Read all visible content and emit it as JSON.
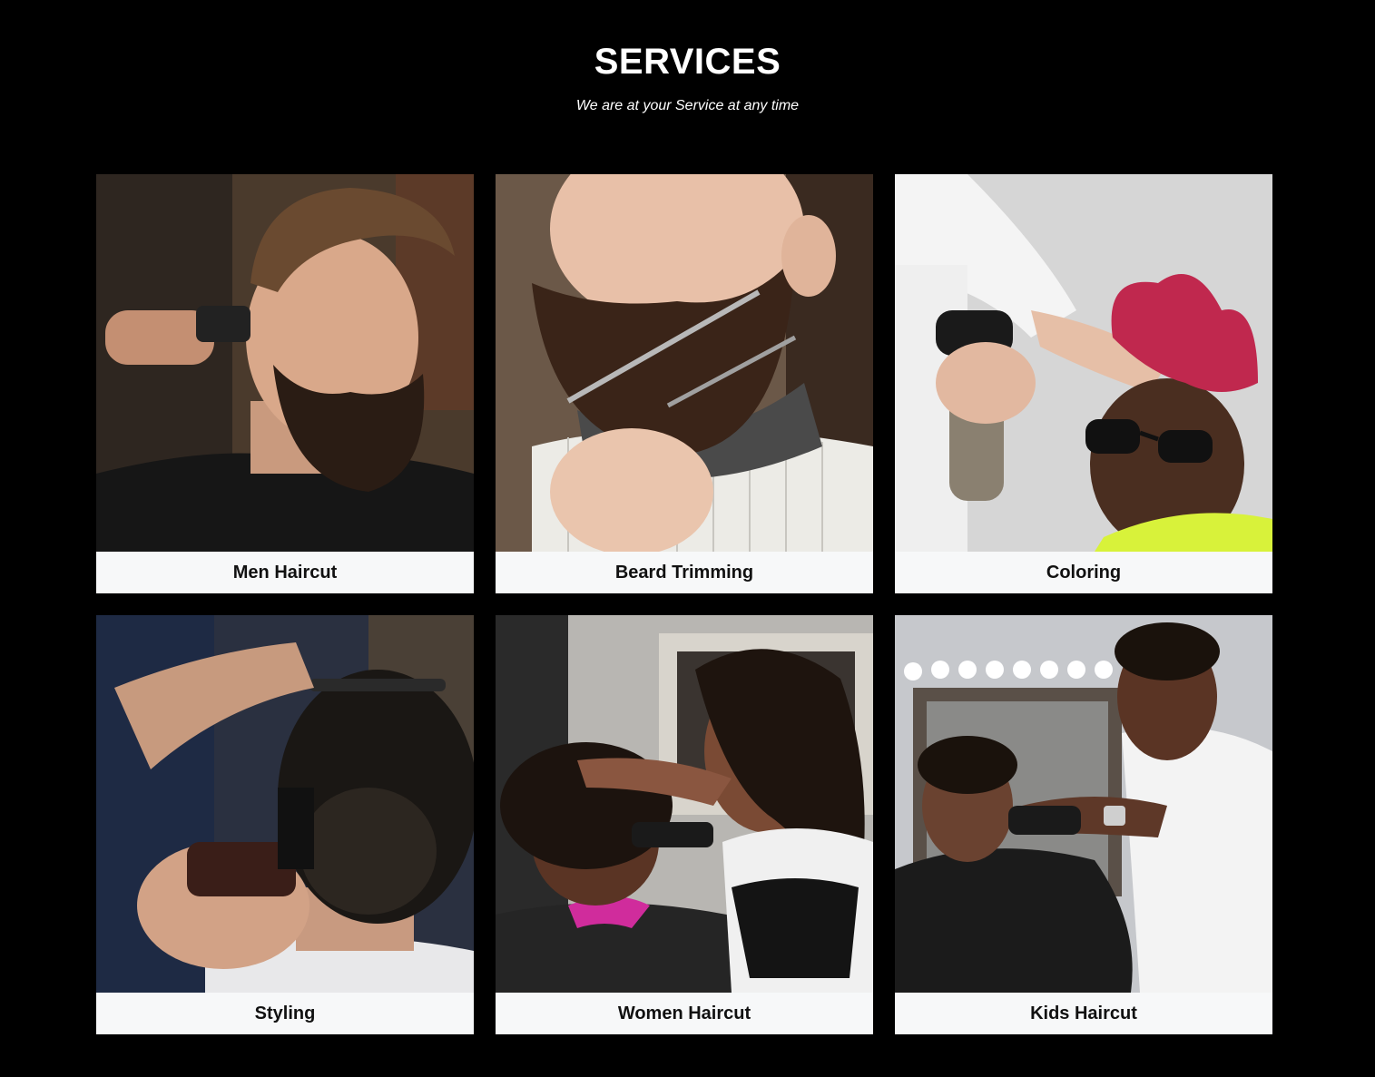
{
  "services": {
    "title": "SERVICES",
    "subtitle": "We are at your Service at any time",
    "items": [
      {
        "label": "Men Haircut"
      },
      {
        "label": "Beard Trimming"
      },
      {
        "label": "Coloring"
      },
      {
        "label": "Styling"
      },
      {
        "label": "Women Haircut"
      },
      {
        "label": "Kids Haircut"
      }
    ]
  },
  "colors": {
    "background": "#000000",
    "card_label_bg": "#f7f8f9",
    "label_text": "#111111",
    "heading_text": "#ffffff"
  }
}
